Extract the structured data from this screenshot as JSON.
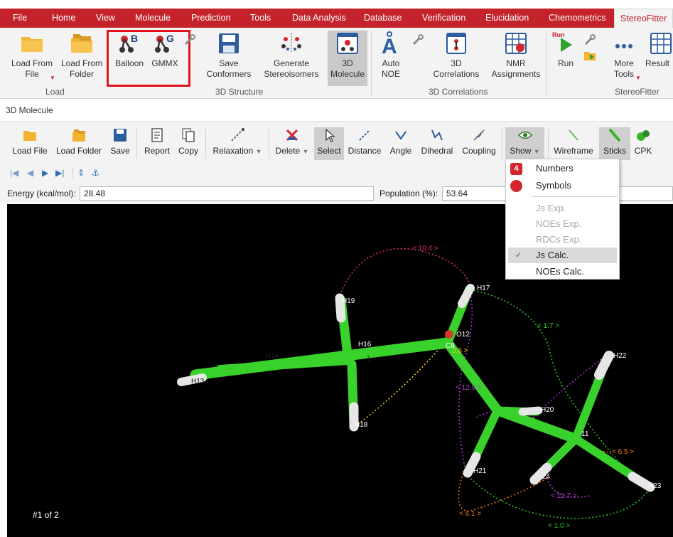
{
  "menu": {
    "tabs": [
      "File",
      "Home",
      "View",
      "Molecule",
      "Prediction",
      "Tools",
      "Data Analysis",
      "Database",
      "Verification",
      "Elucidation",
      "Chemometrics",
      "StereoFitter"
    ],
    "active": "StereoFitter"
  },
  "ribbon": {
    "load_from_file": "Load From\nFile",
    "load_from_folder": "Load From\nFolder",
    "balloon": "Balloon",
    "gmmx": "GMMX",
    "save_conformers": "Save\nConformers",
    "generate_stereoisomers": "Generate\nStereoisomers",
    "molecule_3d": "3D\nMolecule",
    "auto_noe": "Auto\nNOE",
    "correlations_3d": "3D\nCorrelations",
    "nmr_assignments": "NMR\nAssignments",
    "run": "Run",
    "run_small": "Run",
    "more_tools": "More\nTools",
    "results": "Result",
    "groups": {
      "load": "Load",
      "structure_3d": "3D Structure",
      "correlations_3d": "3D Correlations",
      "stereofitter": "StereoFitter"
    }
  },
  "panel": {
    "title": "3D Molecule"
  },
  "toolbar": {
    "load_file": "Load File",
    "load_folder": "Load Folder",
    "save": "Save",
    "report": "Report",
    "copy": "Copy",
    "relaxation": "Relaxation",
    "delete": "Delete",
    "select": "Select",
    "distance": "Distance",
    "angle": "Angle",
    "dihedral": "Dihedral",
    "coupling": "Coupling",
    "show": "Show",
    "wireframe": "Wireframe",
    "sticks": "Sticks",
    "cpk": "CPK"
  },
  "fields": {
    "energy_label": "Energy (kcal/mol):",
    "energy_value": "28.48",
    "population_label": "Population (%):",
    "population_value": "53.64"
  },
  "show_menu": {
    "numbers": "Numbers",
    "symbols": "Symbols",
    "js_exp": "Js Exp.",
    "noes_exp": "NOEs Exp.",
    "rdcs_exp": "RDCs Exp.",
    "js_calc": "Js Calc.",
    "noes_calc": "NOEs Calc.",
    "numbers_badge": "4"
  },
  "viewport": {
    "conformer_label": "#1 of 2",
    "atoms": {
      "h17": "H17",
      "h19": "H19",
      "h16": "H16",
      "o12": "O12",
      "c8": "C8",
      "h22": "H22",
      "h20": "H20",
      "h18": "H18",
      "h21": "H21",
      "h23": "H23",
      "h13": "H13",
      "c11": "11",
      "c24": "24",
      "c1": "1",
      "h14": "H14"
    },
    "distances": {
      "d1": "< 10.4 >",
      "d2": "< 1.7 >",
      "d3": "< 12.9 >",
      "d4": "< 6.5 >",
      "d5": "< 12.7 >",
      "d6": "< 6.1 >",
      "d7": "< 1.0 >",
      "d8": "3.6 >"
    }
  },
  "colors": {
    "accent": "#c4232b",
    "highlight": "#e0151b",
    "bond": "#39d12c",
    "hydrogen": "#e6e6e6"
  }
}
